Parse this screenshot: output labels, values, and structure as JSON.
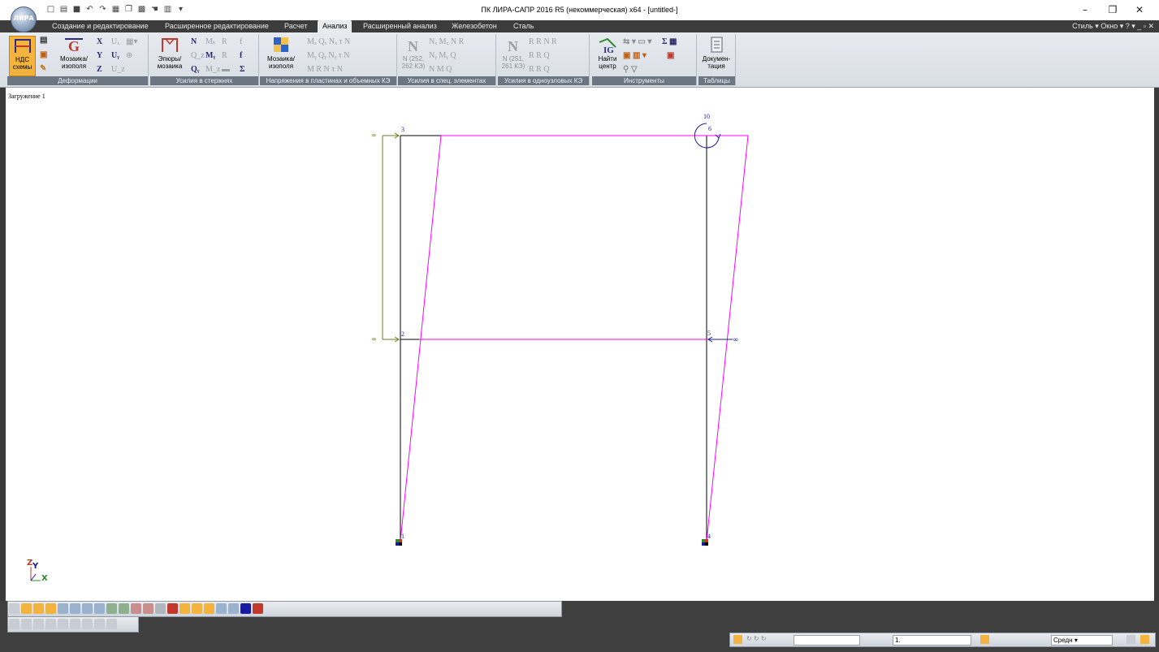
{
  "window": {
    "title": "ПК ЛИРА-САПР  2016 R5 (некоммерческая) x64 - [untitled-]",
    "controls": {
      "minimize": "–",
      "restore": "❐",
      "close": "✕"
    }
  },
  "ribbon": {
    "tabs": [
      {
        "label": "Создание и редактирование"
      },
      {
        "label": "Расширенное редактирование"
      },
      {
        "label": "Расчет"
      },
      {
        "label": "Анализ",
        "active": true
      },
      {
        "label": "Расширенный анализ"
      },
      {
        "label": "Железобетон"
      },
      {
        "label": "Сталь"
      }
    ],
    "right_menu": {
      "style": "Стиль",
      "window": "Окно"
    },
    "groups": {
      "deformations": {
        "label": "Деформации",
        "nds_btn": "НДС схемы",
        "mosaic_btn": "Мозаика/ изополя",
        "x": "X",
        "y": "Y",
        "z": "Z",
        "ux": "Uₓ",
        "uy": "Uᵧ",
        "uz": "U_z"
      },
      "rod_forces": {
        "label": "Усилия в стержнях",
        "diagrams_btn": "Эпюры/ мозаика",
        "n": "N",
        "qz": "Q_z",
        "qy": "Qᵧ",
        "my": "Mᵧ",
        "mz": "M_z",
        "mk": "Mₖ"
      },
      "stresses": {
        "label": "Напряжения в пластинах и объемных КЭ",
        "mosaic_btn": "Мозаика/ изополя"
      },
      "special": {
        "label": "Усилия в спец. элементах",
        "n_btn": "N (252, 262 КЭ)"
      },
      "singlenode": {
        "label": "Усилия в одноузловых КЭ",
        "n_btn": "N (251, 261 КЭ)"
      },
      "tools": {
        "label": "Инструменты",
        "find_btn": "Найти центр"
      },
      "tables": {
        "label": "Таблицы",
        "doc_btn": "Докумен- тация"
      }
    }
  },
  "canvas": {
    "load_case": "Загружение 1",
    "nodes": [
      "1",
      "2",
      "3",
      "4",
      "5",
      "6",
      "10"
    ],
    "axis_labels": {
      "z": "Z",
      "y": "Y",
      "x": "X"
    },
    "colors": {
      "undeformed": "#000000",
      "deformed": "#ff00ff",
      "load": "#6b7a1e",
      "node_label": "#1a1aa0"
    }
  },
  "statusbar": {
    "input_value": "1.",
    "dropdown": "Средн"
  }
}
